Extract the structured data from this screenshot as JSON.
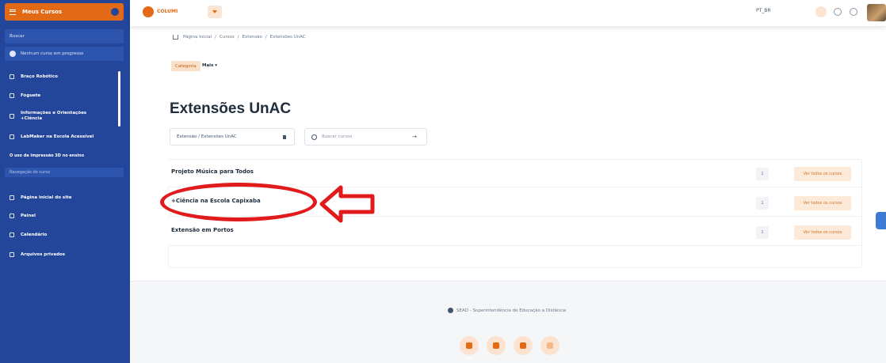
{
  "sidebar": {
    "header_label": "Meus Cursos",
    "search_label": "Buscar",
    "progress_label": "Nenhum curso em progresso",
    "course_items": [
      {
        "label": "Braço Robótico"
      },
      {
        "label": "Foguete"
      },
      {
        "label": "Informações e Orientações +Ciência"
      },
      {
        "label": "LabMaker na Escola Acessível"
      },
      {
        "label": "O uso da impressão 3D no ensino"
      }
    ],
    "section_label": "Navegação do curso",
    "nav_items": [
      {
        "label": "Página inicial do site"
      },
      {
        "label": "Painel"
      },
      {
        "label": "Calendário"
      },
      {
        "label": "Arquivos privados"
      }
    ]
  },
  "topbar": {
    "logo_text": "COLUMI",
    "language": "PT_BR"
  },
  "breadcrumb": [
    "Página Inicial",
    "Cursos",
    "Extensão",
    "Extensões UnAC"
  ],
  "category_bar": {
    "chip_label": "Categoria",
    "more_label": "Mais"
  },
  "page": {
    "title": "Extensões UnAC",
    "category_select": "Extensão / Extensões UnAC",
    "search_placeholder": "Buscar cursos"
  },
  "categories": [
    {
      "name": "Projeto Música para Todos",
      "count": "1",
      "view_all": "Ver todos os cursos"
    },
    {
      "name": "+Ciência na Escola Capixaba",
      "count": "1",
      "view_all": "Ver todos os cursos"
    },
    {
      "name": "Extensão em Portos",
      "count": "1",
      "view_all": "Ver todos os cursos"
    }
  ],
  "footer": {
    "text": "SEAD - Superintendência de Educação a Distância"
  },
  "colors": {
    "sidebar_bg": "#23469a",
    "accent": "#e26a17",
    "annotation": "#e11b1b"
  }
}
